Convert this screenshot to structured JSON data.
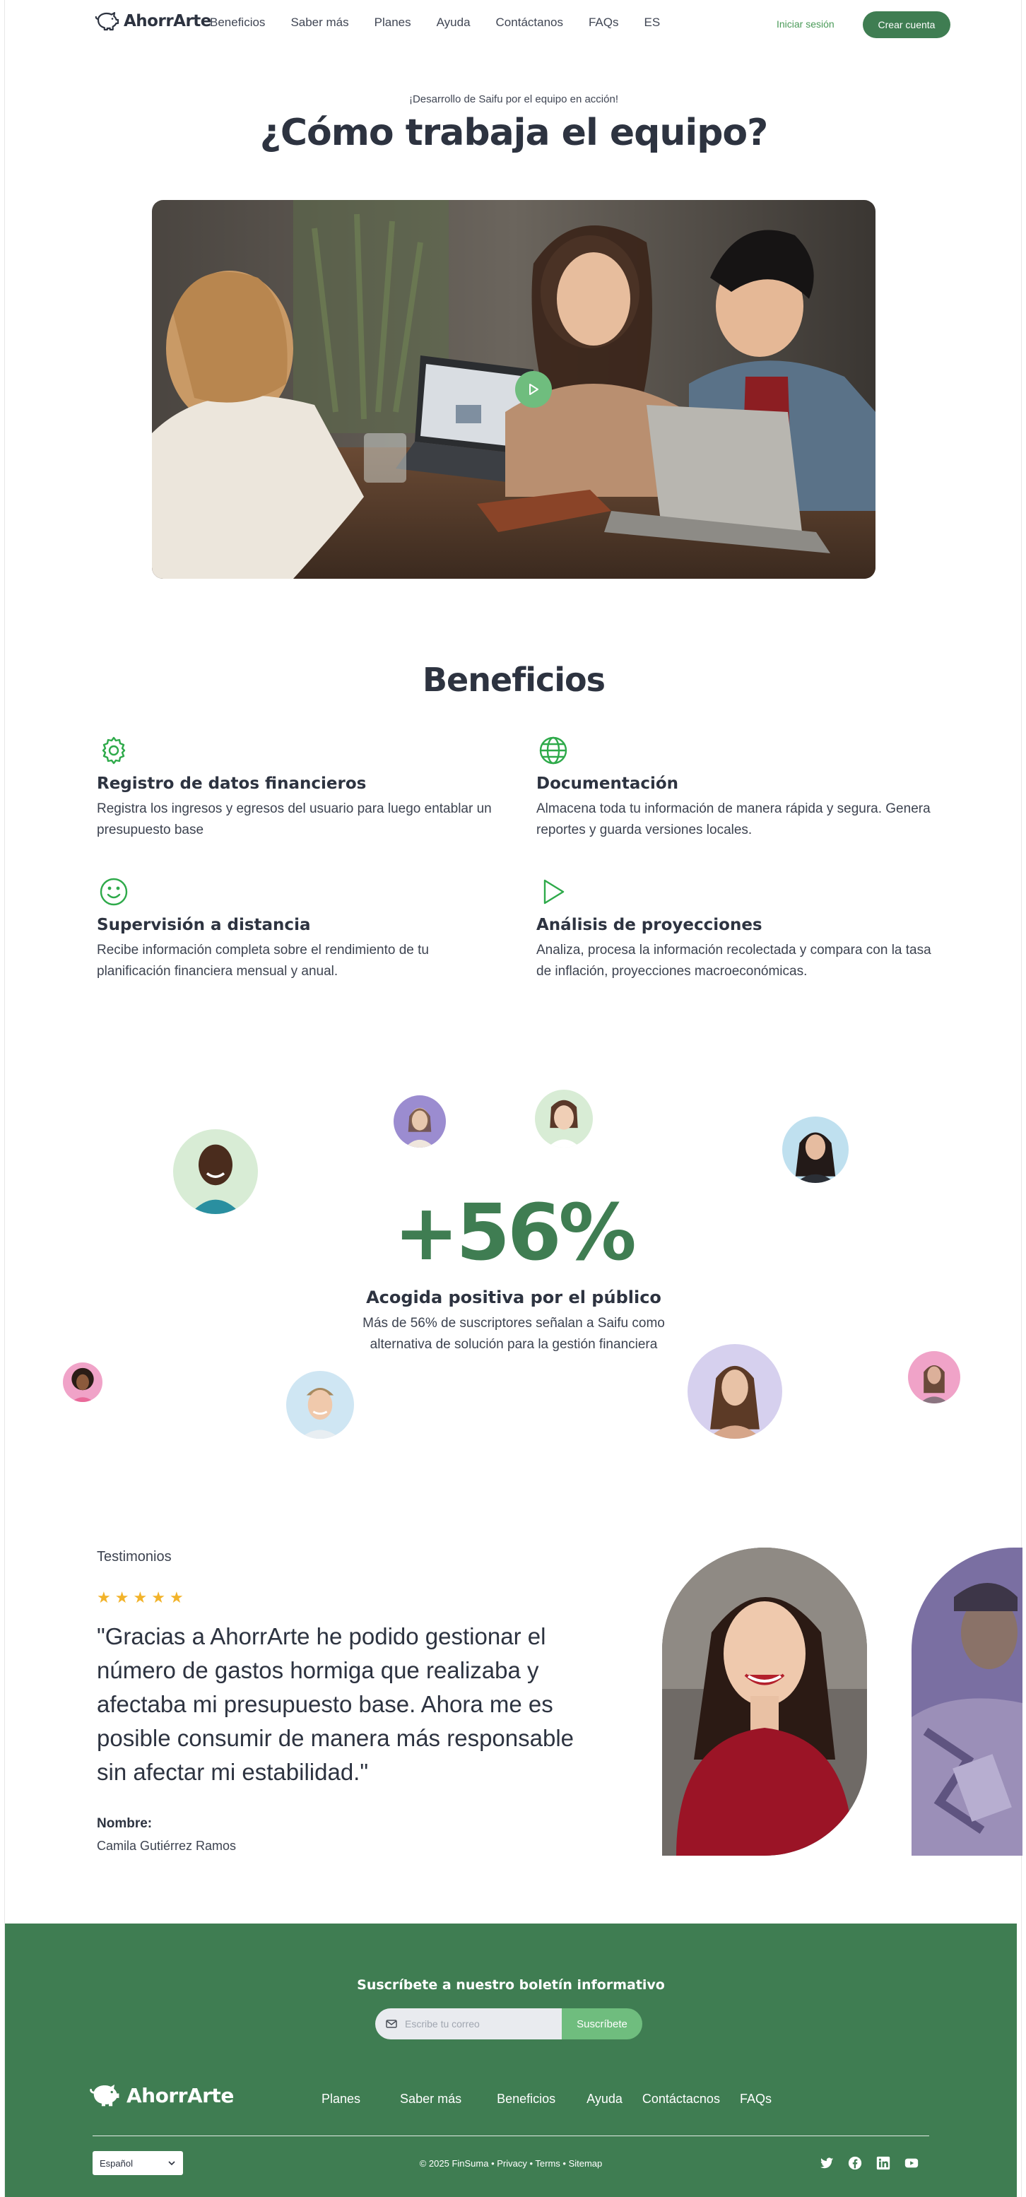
{
  "brand": {
    "name": "AhorrArte",
    "accent": "#3f7d52",
    "accent_light": "#6fbd7e"
  },
  "nav": {
    "links": [
      "Beneficios",
      "Saber más",
      "Planes",
      "Ayuda",
      "Contáctanos",
      "FAQs"
    ],
    "lang": "ES",
    "login": "Iniciar sesión",
    "signup": "Crear cuenta"
  },
  "hero": {
    "eyebrow": "¡Desarrollo de Saifu  por el equipo en acción!",
    "title": "¿Cómo trabaja el equipo?",
    "play_icon": "play-icon"
  },
  "benefits": {
    "title": "Beneficios",
    "items": [
      {
        "icon": "gear-icon",
        "title": "Registro de datos financieros",
        "text": "Registra los ingresos y egresos del usuario para luego entablar un presupuesto base"
      },
      {
        "icon": "globe-icon",
        "title": "Documentación",
        "text": "Almacena toda tu información de manera rápida y segura. Genera reportes y guarda versiones locales."
      },
      {
        "icon": "smile-icon",
        "title": "Supervisión a distancia",
        "text": "Recibe información completa sobre el rendimiento de tu planificación financiera mensual y anual."
      },
      {
        "icon": "play-icon",
        "title": "Análisis de proyecciones",
        "text": "Analiza, procesa la información recolectada y compara con la tasa de inflación, proyecciones macroeconómicas."
      }
    ]
  },
  "stats": {
    "value": "+56%",
    "heading": "Acogida positiva por el público",
    "text": "Más de 56% de suscriptores señalan a Saifu como alternativa de solución para la gestión financiera"
  },
  "testimonial": {
    "label": "Testimonios",
    "rating": 5,
    "quote": "\"Gracias a AhorrArte he podido gestionar el número de gastos hormiga que realizaba y afectaba mi presupuesto base. Ahora me es posible consumir de manera más responsable sin afectar mi estabilidad.\"",
    "name_label": "Nombre:",
    "name": "Camila Gutiérrez Ramos"
  },
  "footer": {
    "newsletter_title": "Suscríbete a nuestro boletín informativo",
    "email_placeholder": "Escribe tu correo",
    "subscribe": "Suscríbete",
    "links": [
      "Planes",
      "Saber más",
      "Beneficios",
      "Ayuda",
      "Contáctacnos",
      "FAQs"
    ],
    "language": "Español",
    "copyright": "© 2025 FinSuma • Privacy • Terms • Sitemap",
    "socials": [
      "twitter-icon",
      "facebook-icon",
      "linkedin-icon",
      "youtube-icon"
    ]
  }
}
